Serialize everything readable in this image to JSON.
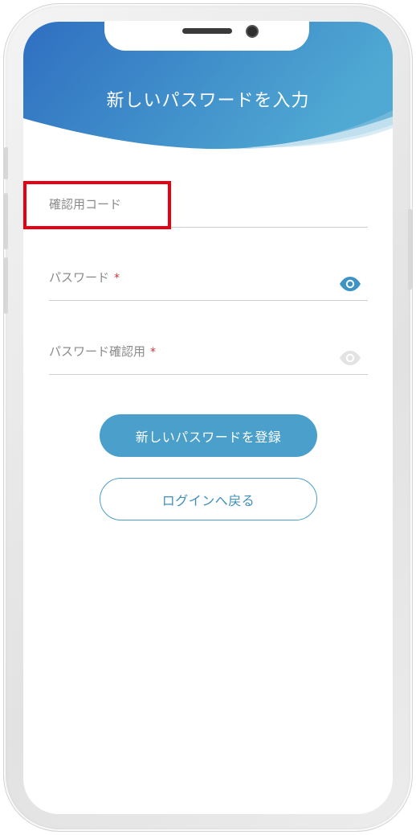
{
  "header": {
    "title": "新しいパスワードを入力",
    "gradient_start": "#2f6fc1",
    "gradient_end": "#4fa9d2"
  },
  "form": {
    "verification_code": {
      "label": "確認用コード"
    },
    "password": {
      "label": "パスワード",
      "required_mark": "*",
      "icon": "eye-icon"
    },
    "password_confirm": {
      "label": "パスワード確認用",
      "required_mark": "*",
      "icon": "eye-icon"
    }
  },
  "buttons": {
    "register_label": "新しいパスワードを登録",
    "back_label": "ログインへ戻る"
  },
  "colors": {
    "accent": "#4a9fcb",
    "required": "#d0333a",
    "highlight": "#e60012"
  }
}
